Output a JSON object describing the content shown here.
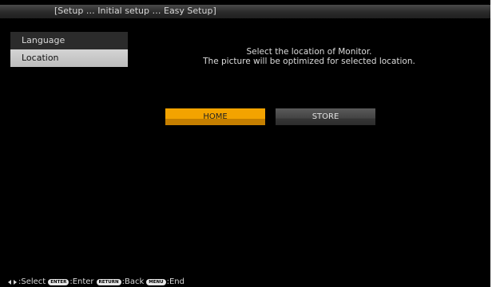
{
  "title_bar": {
    "text": "[Setup … Initial setup … Easy Setup]"
  },
  "sidebar": {
    "items": [
      {
        "label": "Language",
        "state": "inactive"
      },
      {
        "label": "Location",
        "state": "selected"
      }
    ]
  },
  "main": {
    "prompt_line1": "Select the location of Monitor.",
    "prompt_line2": "The picture will be optimized for selected location.",
    "options": [
      {
        "label": "HOME",
        "state": "highlighted"
      },
      {
        "label": "STORE",
        "state": "normal"
      }
    ]
  },
  "footer": {
    "select_text": ":Select",
    "enter_key": "ENTER",
    "enter_text": ":Enter",
    "return_key": "RETURN",
    "back_text": ":Back",
    "menu_key": "MENU",
    "end_text": ":End"
  },
  "colors": {
    "background": "#000000",
    "highlight": "#f3a300",
    "selected_item": "#c8c8c8",
    "button_normal": "#434343",
    "text": "#d8d8d8"
  },
  "icons": [
    "left-arrow-icon",
    "right-arrow-icon"
  ]
}
